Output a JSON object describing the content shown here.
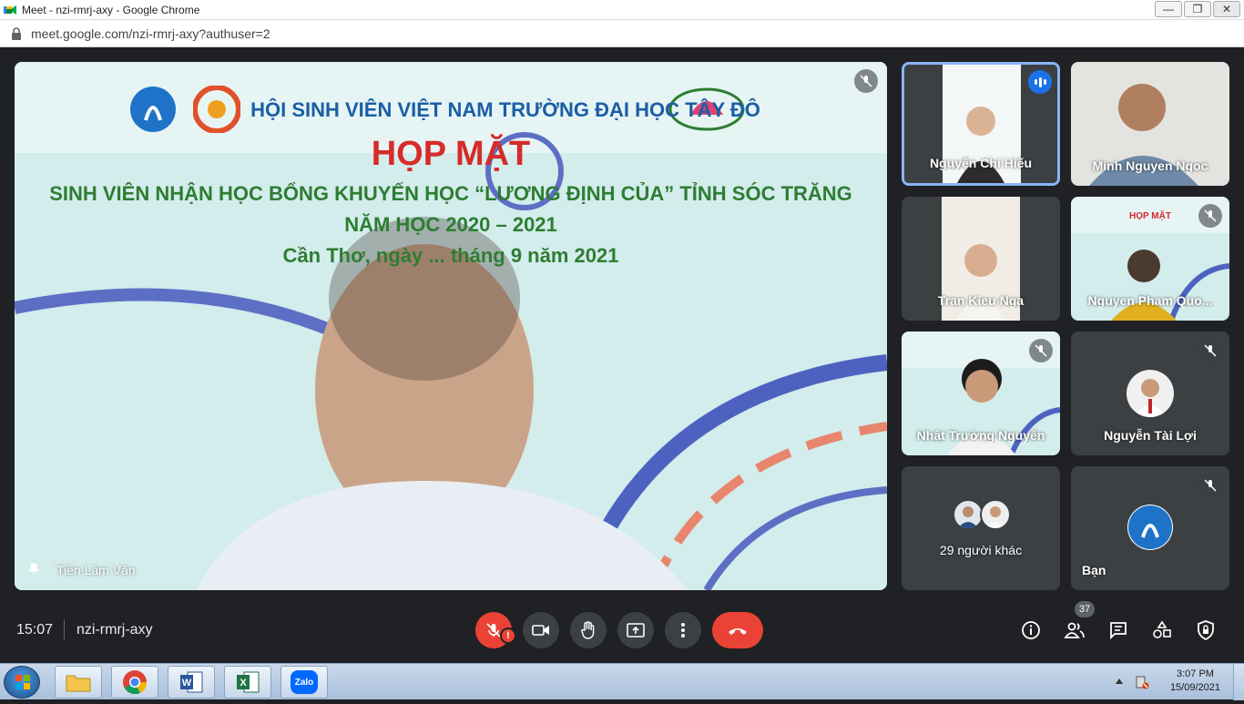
{
  "window": {
    "title": "Meet - nzi-rmrj-axy - Google Chrome",
    "minimize": "—",
    "maximize": "❐",
    "close": "✕"
  },
  "browser": {
    "url": "meet.google.com/nzi-rmrj-axy?authuser=2"
  },
  "main_tile": {
    "banner": {
      "org": "HỘI SINH VIÊN VIỆT NAM TRƯỜNG ĐẠI HỌC TÂY ĐÔ",
      "heading": "HỌP MẶT",
      "line1": "SINH VIÊN NHẬN HỌC BỔNG KHUYẾN HỌC “LƯƠNG ĐỊNH CỦA” TỈNH SÓC TRĂNG",
      "line2": "NĂM HỌC 2020 – 2021",
      "line3": "Cần Thơ, ngày ... tháng 9 năm 2021"
    },
    "participant": "Tiền Lâm Văn"
  },
  "tiles": [
    {
      "name": "Nguyễn Chí Hiếu",
      "state": "speaking"
    },
    {
      "name": "Minh Nguyen Ngoc"
    },
    {
      "name": "Tran Kieu Nga"
    },
    {
      "name": "Nguyen Pham Quo...",
      "state": "muted"
    },
    {
      "name": "Nhật Trường Nguyễn",
      "state": "muted"
    },
    {
      "name": "Nguyễn Tài Lợi",
      "state": "muted"
    },
    {
      "name": "29 người khác"
    },
    {
      "name": "Bạn",
      "state": "muted"
    }
  ],
  "bottom_bar": {
    "time": "15:07",
    "code": "nzi-rmrj-axy",
    "participants_count": "37",
    "mic_warning": "!"
  },
  "taskbar": {
    "time": "3:07 PM",
    "date": "15/09/2021",
    "zalo_label": "Zalo"
  },
  "colors": {
    "accent": "#8ab4f8",
    "danger": "#ea4335",
    "surface": "#3c4043",
    "background": "#202124"
  }
}
